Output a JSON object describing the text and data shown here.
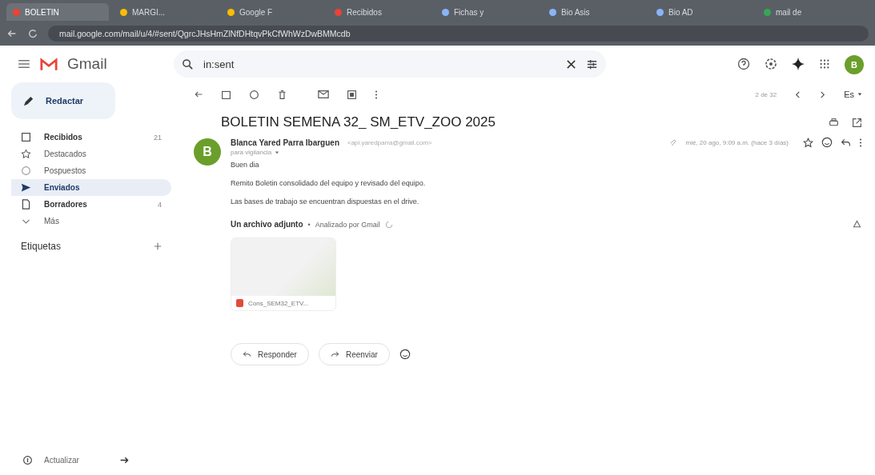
{
  "browser": {
    "tabs": [
      {
        "label": "BOLETIN",
        "kind": "gmail",
        "selected": true
      },
      {
        "label": "MARGI...",
        "kind": "drive",
        "selected": false
      },
      {
        "label": "Google F",
        "kind": "drive",
        "selected": false
      },
      {
        "label": "Recibidos",
        "kind": "gmail",
        "selected": false
      },
      {
        "label": "Fichas y",
        "kind": "globe",
        "selected": false
      },
      {
        "label": "Bio Asis",
        "kind": "globe",
        "selected": false
      },
      {
        "label": "Bio AD",
        "kind": "globe",
        "selected": false
      },
      {
        "label": "mail de",
        "kind": "chrome",
        "selected": false
      }
    ],
    "url": "mail.google.com/mail/u/4/#sent/QgrcJHsHmZlNfDHtqvPkCfWhWzDwBMMcdb"
  },
  "app": {
    "name": "Gmail",
    "search": {
      "value": "in:sent"
    },
    "avatar": "B"
  },
  "sidebar": {
    "compose": "Redactar",
    "items": [
      {
        "label": "Recibidos",
        "kind": "inbox",
        "count": "21",
        "selected": false,
        "bold": true
      },
      {
        "label": "Destacados",
        "kind": "star",
        "selected": false,
        "bold": false
      },
      {
        "label": "Pospuestos",
        "kind": "clock",
        "selected": false,
        "bold": false
      },
      {
        "label": "Enviados",
        "kind": "send",
        "selected": true,
        "bold": true
      },
      {
        "label": "Borradores",
        "kind": "draft",
        "count": "4",
        "selected": false,
        "bold": true
      },
      {
        "label": "Más",
        "kind": "chevron",
        "selected": false,
        "bold": false
      }
    ],
    "labels_heading": "Etiquetas",
    "footer": "Actualizar"
  },
  "toolbar": {
    "counter": "2 de 32",
    "language": "Es"
  },
  "message": {
    "subject": "BOLETIN SEMENA 32_ SM_ETV_ZOO 2025",
    "sender_initial": "B",
    "sender": "Blanca Yared Parra Ibarguen",
    "sender_email": "<api.yaredparra@gmail.com>",
    "recipient": "para vigilancia",
    "date": "mié, 20 ago, 9:09 a.m. (hace 3 días)",
    "body": [
      "Buen dia",
      "Remito Boletin consolidado del equipo y revisado del equipo.",
      "Las bases de trabajo se encuentran dispuestas en el drive."
    ],
    "attachments_heading": "Un archivo adjunto",
    "separator": "•",
    "scan_note": "Analizado por Gmail",
    "attachment": "Cons_SEM32_ETV...",
    "actions": [
      "Responder",
      "Reenviar"
    ]
  }
}
